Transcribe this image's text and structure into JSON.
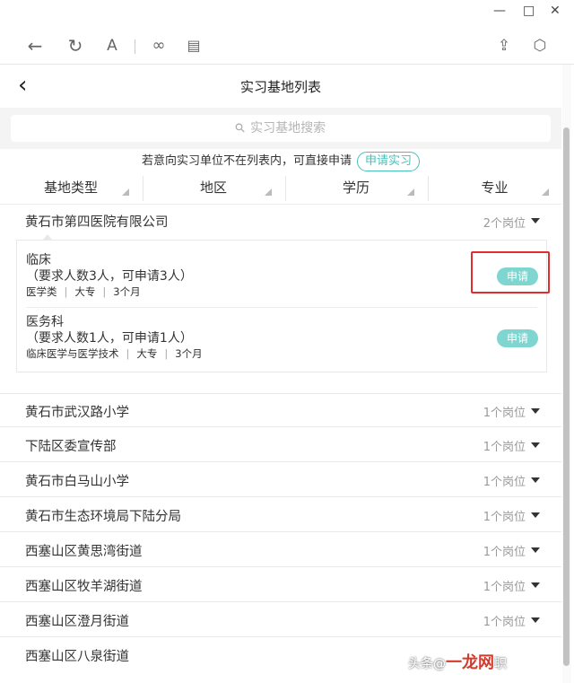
{
  "window": {
    "minimize": "—",
    "maximize": "□",
    "close": "✕"
  },
  "toolbar": {
    "back_glyph": "←",
    "refresh_glyph": "↻",
    "font_glyph": "A",
    "link_glyph": "∞",
    "window_glyph": "▤",
    "share_glyph": "⇪",
    "cube_glyph": "⬡"
  },
  "page": {
    "back_glyph": "‹",
    "title": "实习基地列表"
  },
  "search": {
    "icon": "⚲",
    "placeholder": "实习基地搜索"
  },
  "notice": {
    "text": "若意向实习单位不在列表内，可直接申请",
    "apply_label": "申请实习"
  },
  "filters": [
    "基地类型",
    "地区",
    "学历",
    "专业"
  ],
  "expanded": {
    "name": "黄石市第四医院有限公司",
    "count": "2个岗位",
    "positions": [
      {
        "name": "临床",
        "requirement": "（要求人数3人，可申请3人）",
        "major": "医学类",
        "degree": "大专",
        "duration": "3个月",
        "apply_label": "申请",
        "highlighted": true
      },
      {
        "name": "医务科",
        "requirement": "（要求人数1人，可申请1人）",
        "major": "临床医学与医学技术",
        "degree": "大专",
        "duration": "3个月",
        "apply_label": "申请",
        "highlighted": false
      }
    ]
  },
  "bases": [
    {
      "name": "黄石市武汉路小学",
      "count": "1个岗位"
    },
    {
      "name": "下陆区委宣传部",
      "count": "1个岗位"
    },
    {
      "name": "黄石市白马山小学",
      "count": "1个岗位"
    },
    {
      "name": "黄石市生态环境局下陆分局",
      "count": "1个岗位"
    },
    {
      "name": "西塞山区黄思湾街道",
      "count": "1个岗位"
    },
    {
      "name": "西塞山区牧羊湖街道",
      "count": "1个岗位"
    },
    {
      "name": "西塞山区澄月街道",
      "count": "1个岗位"
    },
    {
      "name": "西塞山区八泉街道",
      "count": ""
    }
  ],
  "watermark": {
    "prefix": "头条@",
    "brand": "一龙网",
    "suffix": "职"
  },
  "colors": {
    "accent": "#46c1b9",
    "apply_button": "#7fd6d0",
    "highlight": "#e02d2d"
  }
}
